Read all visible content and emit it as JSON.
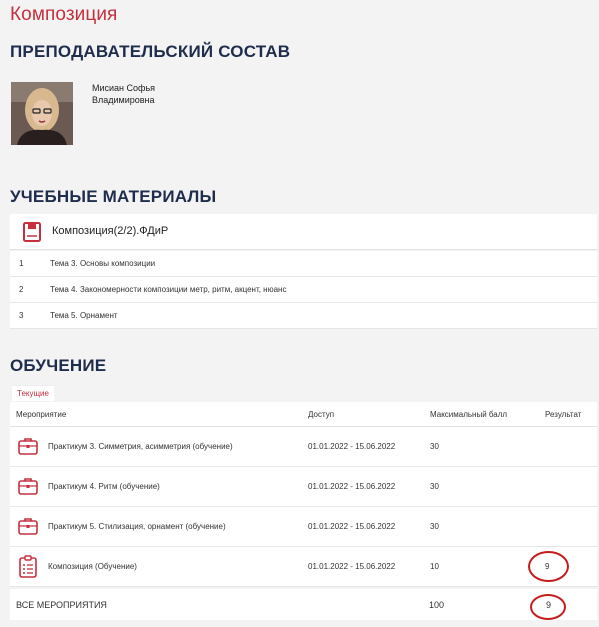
{
  "page": {
    "title": "Композиция"
  },
  "teachers": {
    "heading": "ПРЕПОДАВАТЕЛЬСКИЙ СОСТАВ",
    "name_line1": "Мисиан Софья",
    "name_line2": "Владимировна"
  },
  "materials": {
    "heading": "УЧЕБНЫЕ МАТЕРИАЛЫ",
    "course_title": "Композиция(2/2).ФДиР",
    "items": [
      {
        "num": "1",
        "title": "Тема 3. Основы композиции"
      },
      {
        "num": "2",
        "title": "Тема 4. Закономерности композиции метр, ритм, акцент, нюанс"
      },
      {
        "num": "3",
        "title": "Тема 5. Орнамент"
      }
    ]
  },
  "learning": {
    "heading": "ОБУЧЕНИЕ",
    "tab": "Текущие",
    "columns": {
      "event": "Мероприятие",
      "access": "Доступ",
      "max": "Максимальный балл",
      "result": "Результат"
    },
    "rows": [
      {
        "name": "Практикум 3. Симметрия, асимметрия (обучение)",
        "access": "01.01.2022 - 15.06.2022",
        "max": "30",
        "result": "",
        "icon": "briefcase-icon"
      },
      {
        "name": "Практикум 4. Ритм (обучение)",
        "access": "01.01.2022 - 15.06.2022",
        "max": "30",
        "result": "",
        "icon": "briefcase-icon"
      },
      {
        "name": "Практикум 5. Стилизация, орнамент (обучение)",
        "access": "01.01.2022 - 15.06.2022",
        "max": "30",
        "result": "",
        "icon": "briefcase-icon"
      },
      {
        "name": "Композиция (Обучение)",
        "access": "01.01.2022 - 15.06.2022",
        "max": "10",
        "result": "9",
        "icon": "clipboard-list-icon"
      }
    ],
    "total": {
      "label": "ВСЕ МЕРОПРИЯТИЯ",
      "max": "100",
      "result": "9"
    }
  },
  "colors": {
    "accent": "#c6303e",
    "heading": "#1f2d4d",
    "annotation": "#c51d1d"
  }
}
